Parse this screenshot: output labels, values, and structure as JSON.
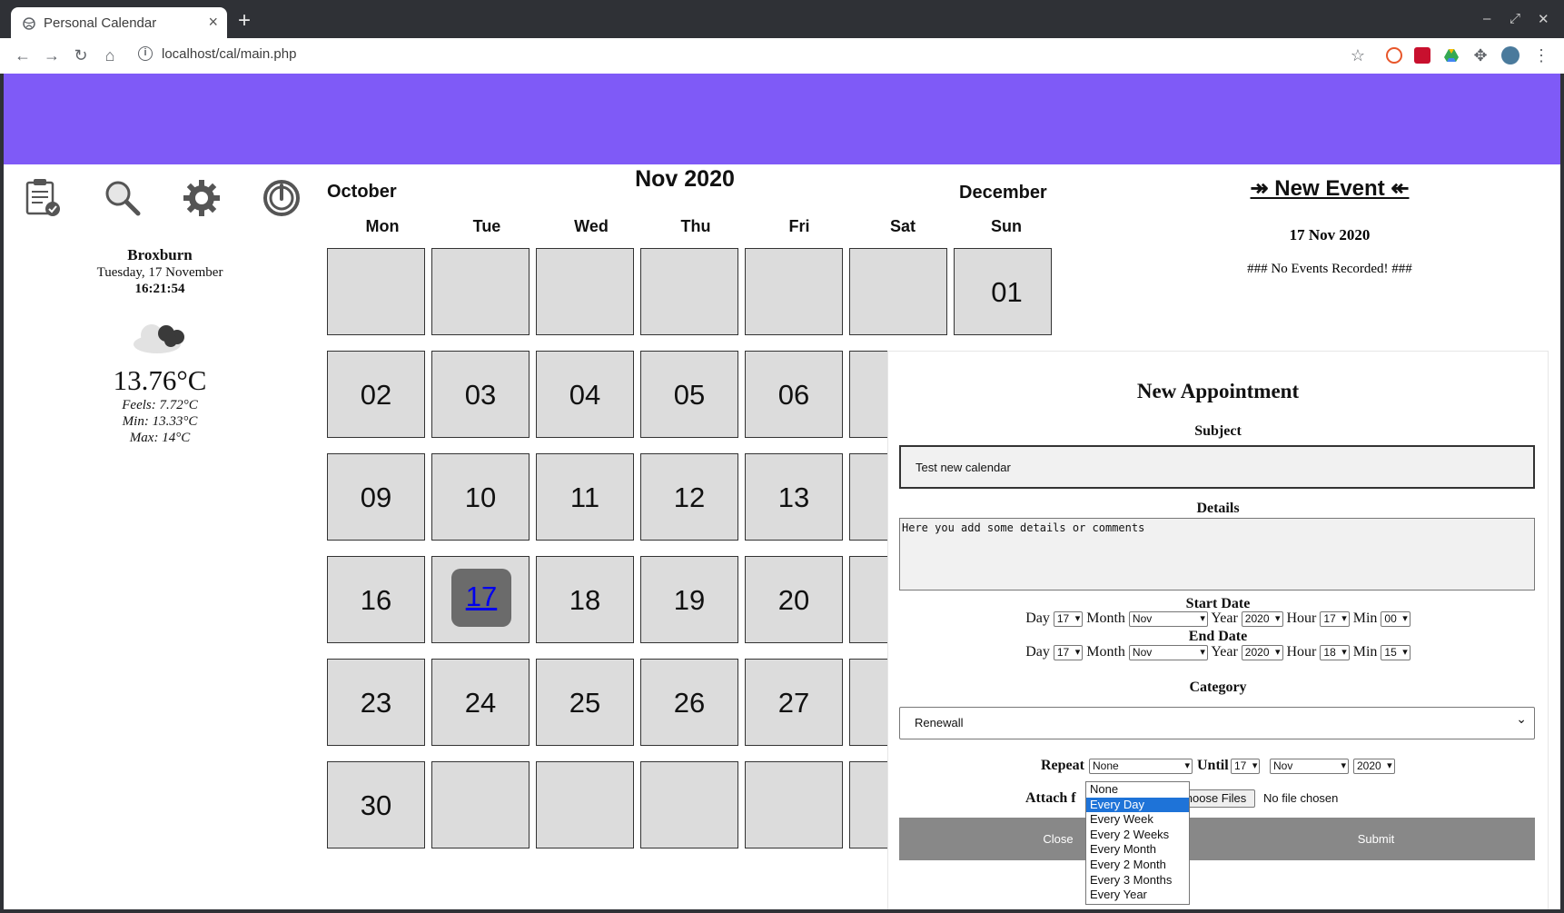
{
  "browser": {
    "tab_title": "Personal Calendar",
    "url": "localhost/cal/main.php",
    "extension_colors": [
      "#e8562a",
      "#c8102e",
      "#34a853",
      "#5f6368"
    ]
  },
  "weather": {
    "city": "Broxburn",
    "date": "Tuesday, 17 November",
    "time": "16:21:54",
    "temp": "13.76°C",
    "feels": "Feels: 7.72°C",
    "min": "Min: 13.33°C",
    "max": "Max: 14°C"
  },
  "calendar": {
    "title": "Nov 2020",
    "prev_month": "October",
    "next_month": "December",
    "weekdays": [
      "Mon",
      "Tue",
      "Wed",
      "Thu",
      "Fri",
      "Sat",
      "Sun"
    ],
    "days": [
      [
        "",
        "",
        "",
        "",
        "",
        "",
        "01"
      ],
      [
        "02",
        "03",
        "04",
        "05",
        "06"
      ],
      [
        "09",
        "10",
        "11",
        "12",
        "13"
      ],
      [
        "16",
        "17",
        "18",
        "19",
        "20"
      ],
      [
        "23",
        "24",
        "25",
        "26",
        "27"
      ],
      [
        "30",
        "",
        "",
        "",
        ""
      ]
    ],
    "today": "17"
  },
  "events_panel": {
    "new_event": "↠ New Event ↞",
    "date": "17 Nov 2020",
    "no_events": "### No Events Recorded! ###"
  },
  "appointment": {
    "title": "New Appointment",
    "subject_label": "Subject",
    "subject_value": "Test new calendar",
    "details_label": "Details",
    "details_value": "Here you add some details or comments",
    "start_label": "Start Date",
    "end_label": "End Date",
    "day_label": "Day",
    "month_label": "Month",
    "year_label": "Year",
    "hour_label": "Hour",
    "min_label": "Min",
    "start": {
      "day": "17",
      "month": "Nov",
      "year": "2020",
      "hour": "17",
      "min": "00"
    },
    "end": {
      "day": "17",
      "month": "Nov",
      "year": "2020",
      "hour": "18",
      "min": "15"
    },
    "category_label": "Category",
    "category_value": "Renewall",
    "repeat_label": "Repeat",
    "repeat_value": "None",
    "until_label": "Until",
    "until": {
      "day": "17",
      "month": "Nov",
      "year": "2020"
    },
    "attach_label": "Attach f",
    "file_button": "hoose Files",
    "no_file": "No file chosen",
    "close": "Close",
    "submit": "Submit",
    "repeat_options": [
      "None",
      "Every Day",
      "Every Week",
      "Every 2 Weeks",
      "Every Month",
      "Every 2 Month",
      "Every 3 Months",
      "Every Year"
    ],
    "highlighted_option": "Every Day"
  }
}
